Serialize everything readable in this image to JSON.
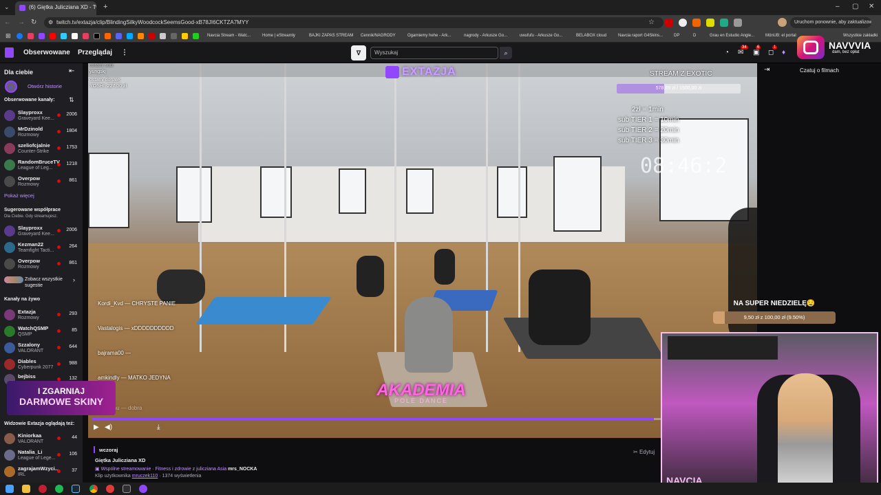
{
  "browser": {
    "tab_title": "(6) Giętka Julicziana XD - Twit...",
    "url": "twitch.tv/extazja/clip/BlindingSilkyWoodcockSeemsGood-xB78JI6CKTZA7MYY",
    "restart_label": "Uruchom ponownie, aby zaktualizować",
    "bookmarks": [
      "Navcia Stream - Watc...",
      "Home | eStreamly",
      "BAJKI ZAPAS STREAM",
      "Cennik/NAGRODY",
      "Ogarniemy hehe - Ark...",
      "nagrody - Arkusze Go...",
      "uwufufu - Arkusze Go...",
      "BELABOX cloud",
      "Navcia raport G4Skins...",
      "DP",
      "D",
      "Grau en Estudio Angle...",
      "MönUB: el portal",
      "Wszystkie zakładki"
    ]
  },
  "nav": {
    "following": "Obserwowane",
    "browse": "Przeglądaj",
    "search_placeholder": "Wyszukaj",
    "badge_1": "34",
    "badge_2": "6",
    "badge_3": "1"
  },
  "sidebar": {
    "for_you": "Dla ciebie",
    "open_stories": "Otwórz historie",
    "followed_header": "Obserwowane kanały:",
    "followed": [
      {
        "name": "Slayproxx",
        "game": "Graveyard Kee...",
        "viewers": "2006"
      },
      {
        "name": "MrDzinold",
        "game": "Rozmowy",
        "viewers": "1804"
      },
      {
        "name": "szeliofcjalnie",
        "game": "Counter-Strike",
        "viewers": "1753"
      },
      {
        "name": "RandomBruceTV",
        "game": "League of Leg...",
        "viewers": "1218"
      },
      {
        "name": "Overpow",
        "game": "Rozmowy",
        "viewers": "861"
      }
    ],
    "show_more": "Pokaż więcej",
    "suggested_header": "Sugerowane współprace",
    "suggested_note": "Dla Ciebie. Gdy streamujesz.",
    "suggested": [
      {
        "name": "Slayproxx",
        "game": "Graveyard Kee...",
        "viewers": "2006"
      },
      {
        "name": "Kezman22",
        "game": "Teamfight Tacti...",
        "viewers": "264"
      },
      {
        "name": "Overpow",
        "game": "Rozmowy",
        "viewers": "861"
      }
    ],
    "see_all": "Zobacz wszystkie sugestie",
    "live_header": "Kanały na żywo",
    "live": [
      {
        "name": "Extazja",
        "game": "Rozmowy",
        "viewers": "293"
      },
      {
        "name": "WatchQSMP",
        "game": "QSMP",
        "viewers": "85"
      },
      {
        "name": "Szzalony",
        "game": "VALORANT",
        "viewers": "644"
      },
      {
        "name": "Diables",
        "game": "Cyberpunk 2077",
        "viewers": "988"
      },
      {
        "name": "bejbiss",
        "game": "",
        "viewers": "132"
      }
    ],
    "viewers_also_header": "Widzowie Extazja oglądają też:",
    "viewers_also": [
      {
        "name": "Kiniorkaa",
        "game": "VALORANT",
        "viewers": "44"
      },
      {
        "name": "Natalia_Li",
        "game": "League of Lege...",
        "viewers": "106"
      },
      {
        "name": "zagrajamWzyci...",
        "game": "IRL",
        "viewers": "37"
      }
    ],
    "promo_line1": "I ZGARNIAJ",
    "promo_line2": "DARMOWE SKINY"
  },
  "video": {
    "last_sub_label": "ostatni sub:",
    "last_sub_name": "yungskj",
    "last_donate_label": "ostatni donate:",
    "last_donate": "YOSHI: 227,00 zł",
    "brand": "EXTAZJA",
    "goal_title": "STREAM Z EXOTIC",
    "goal_value": "578,69 zł / 1500,00 zł",
    "goal_fraction": 0.386,
    "rules": [
      "2zł = 1min",
      "sub TIER 1 = 10min",
      "sub TIER 2 = 20min",
      "sub TIER 3 = 30min"
    ],
    "timer": "08:46:2",
    "chat": [
      "Kordi_Kvd — CHRYSTE PANIE",
      "Vastalogis — xDDDDDDDDDD",
      "bajrama00 —",
      "amkindly — MATKO JEDYNA",
      "kulczanu — dobra"
    ],
    "logo_main": "AKADEMIA",
    "logo_sub": "POLE DANCE",
    "progress": 0.85
  },
  "clip": {
    "date": "wczoraj",
    "title": "Giętka Julicziana XD",
    "co_stream": "Wspólne streamowanie",
    "category": "Fitness i zdrowie",
    "with_label": "z",
    "partners": [
      "julicziana",
      "Asia",
      "mrs_NOCKA"
    ],
    "clip_by_label": "Klip użytkownika",
    "clip_by": "mruczek110",
    "views": "1374 wyświetlenia",
    "edit": "Edytuj"
  },
  "right": {
    "chat_about": "Czatuj o filmach",
    "insta_name": "NAVVVIA",
    "insta_sub": "dam, bez opłat",
    "promo_title": "NA SUPER NIEDZIELĘ🤤",
    "promo_value": "9,50 zł z 100,00 zł (9.50%)",
    "promo_fraction": 0.095,
    "cam_tag": "NAVCIA"
  },
  "colors": {
    "twitch_purple": "#9146ff",
    "live_red": "#eb0400"
  }
}
